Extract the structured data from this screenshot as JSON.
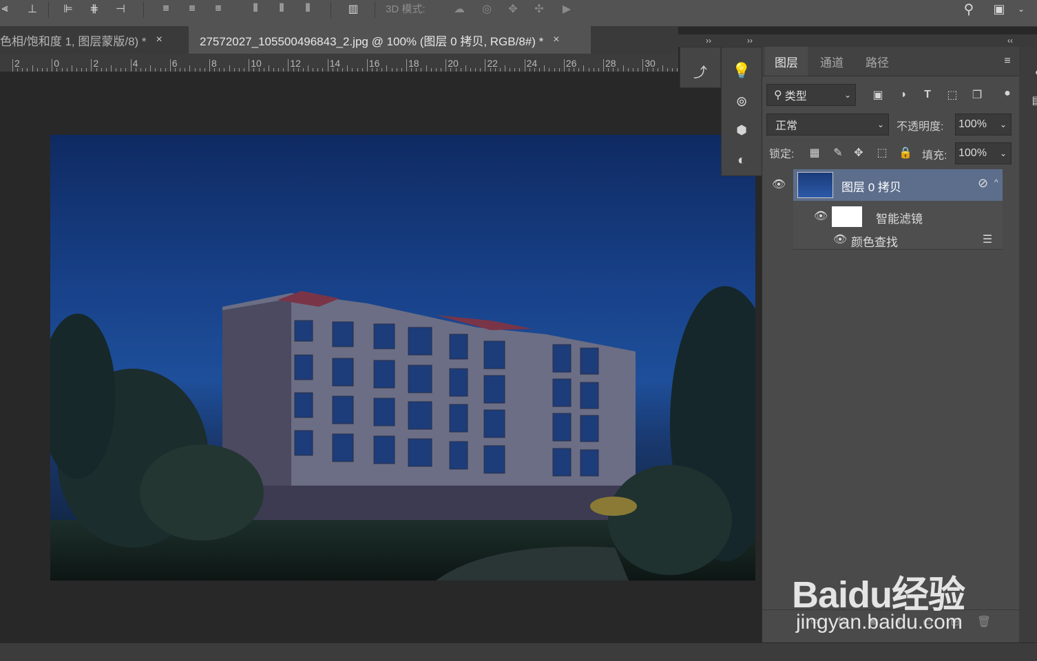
{
  "toolbar": {
    "mode_label": "3D 模式:"
  },
  "tabs": [
    {
      "label": "色相/饱和度 1, 图层蒙版/8) *",
      "close": "×"
    },
    {
      "label": "27572027_105500496843_2.jpg @ 100% (图层 0 拷贝, RGB/8#) *",
      "close": "×"
    }
  ],
  "ruler_labels": [
    "2",
    "0",
    "2",
    "4",
    "6",
    "8",
    "10",
    "12",
    "14",
    "16",
    "18",
    "20",
    "22",
    "24",
    "26",
    "28",
    "30"
  ],
  "dock": {
    "collapse_left": "››",
    "collapse_right": "››",
    "collapse_panel": "‹‹"
  },
  "layers_panel": {
    "tabs": [
      "图层",
      "通道",
      "路径"
    ],
    "filter_kind": "类型",
    "blend_mode": "正常",
    "opacity_label": "不透明度:",
    "opacity_value": "100%",
    "lock_label": "锁定:",
    "fill_label": "填充:",
    "fill_value": "100%",
    "layers": [
      {
        "name": "图层 0 拷贝"
      },
      {
        "name": "智能滤镜"
      },
      {
        "name": "颜色查找"
      }
    ],
    "footer_icons": [
      "link-icon",
      "fx-icon",
      "mask-icon",
      "adjustment-icon",
      "group-icon",
      "new-layer-icon",
      "trash-icon"
    ]
  },
  "watermark": {
    "brand": "Baidu经验",
    "url": "jingyan.baidu.com"
  },
  "colors": {
    "selected_layer": "#5c6e8c",
    "panel_bg": "#4a4a4a",
    "toolbar_bg": "#535353"
  }
}
